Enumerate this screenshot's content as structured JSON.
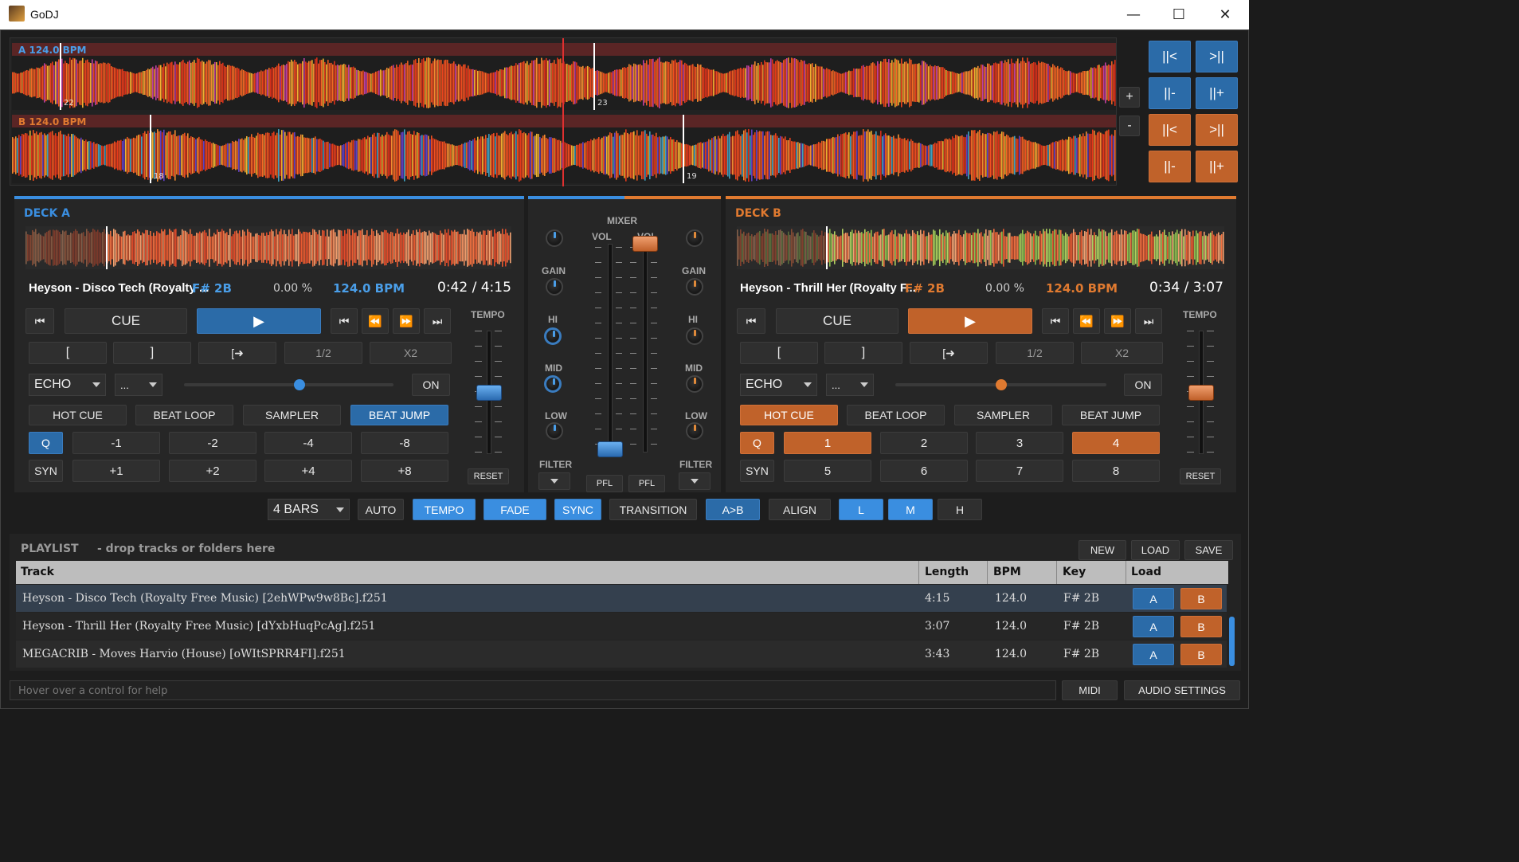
{
  "window": {
    "title": "GoDJ"
  },
  "overview": {
    "a_label": "A  124.0 BPM",
    "b_label": "B  124.0 BPM",
    "a_markers": [
      "22",
      "23"
    ],
    "b_markers": [
      "18",
      "19"
    ],
    "zoom_plus": "+",
    "zoom_minus": "-"
  },
  "jump_buttons": {
    "a": [
      "||<",
      ">||",
      "||-",
      "||+"
    ],
    "b": [
      "||<",
      ">||",
      "||-",
      "||+"
    ]
  },
  "deck_a": {
    "title": "DECK A",
    "track": "Heyson - Disco Tech (Royalty ...",
    "key": "F#  2B",
    "pitch": "0.00 %",
    "bpm": "124.0 BPM",
    "time": "0:42 / 4:15",
    "cue": "CUE",
    "loop_in": "[",
    "loop_out": "]",
    "loop_exit": "[➜",
    "half": "1/2",
    "double": "X2",
    "fx": "ECHO",
    "fx_param": "...",
    "fx_on": "ON",
    "fx_amount": 0.55,
    "tabs": [
      "HOT CUE",
      "BEAT LOOP",
      "SAMPLER",
      "BEAT JUMP"
    ],
    "active_tab": "BEAT JUMP",
    "q": "Q",
    "syn": "SYN",
    "pads_top": [
      "-1",
      "-2",
      "-4",
      "-8"
    ],
    "pads_bottom": [
      "+1",
      "+2",
      "+4",
      "+8"
    ],
    "tempo_label": "TEMPO",
    "reset": "RESET",
    "accent": "#3a8ee0"
  },
  "deck_b": {
    "title": "DECK B",
    "track": "Heyson - Thrill Her (Royalty F...",
    "key": "F#  2B",
    "pitch": "0.00 %",
    "bpm": "124.0 BPM",
    "time": "0:34 / 3:07",
    "cue": "CUE",
    "loop_in": "[",
    "loop_out": "]",
    "loop_exit": "[➜",
    "half": "1/2",
    "double": "X2",
    "fx": "ECHO",
    "fx_param": "...",
    "fx_on": "ON",
    "fx_amount": 0.5,
    "tabs": [
      "HOT CUE",
      "BEAT LOOP",
      "SAMPLER",
      "BEAT JUMP"
    ],
    "active_tab": "HOT CUE",
    "q": "Q",
    "syn": "SYN",
    "pads_top": [
      "1",
      "2",
      "3",
      "4"
    ],
    "pads_bottom": [
      "5",
      "6",
      "7",
      "8"
    ],
    "tempo_label": "TEMPO",
    "reset": "RESET",
    "accent": "#e07a30"
  },
  "mixer": {
    "title": "MIXER",
    "vol": "VOL",
    "gain": "GAIN",
    "hi": "HI",
    "mid": "MID",
    "low": "LOW",
    "filter": "FILTER",
    "pfl": "PFL"
  },
  "transition": {
    "bars": "4 BARS",
    "auto": "AUTO",
    "tempo": "TEMPO",
    "fade": "FADE",
    "sync": "SYNC",
    "transition": "TRANSITION",
    "ab": "A>B",
    "align": "ALIGN",
    "l": "L",
    "m": "M",
    "h": "H"
  },
  "playlist": {
    "title": "PLAYLIST",
    "hint": "-  drop tracks or folders here",
    "new": "NEW",
    "load": "LOAD",
    "save": "SAVE",
    "columns": [
      "Track",
      "Length",
      "BPM",
      "Key",
      "Load"
    ],
    "rows": [
      {
        "track": "Heyson - Disco Tech (Royalty Free Music) [2ehWPw9w8Bc].f251",
        "length": "4:15",
        "bpm": "124.0",
        "key": "F#  2B"
      },
      {
        "track": "Heyson - Thrill Her (Royalty Free Music) [dYxbHuqPcAg].f251",
        "length": "3:07",
        "bpm": "124.0",
        "key": "F#  2B"
      },
      {
        "track": "MEGACRIB - Moves Harvio (House) [oWItSPRR4FI].f251",
        "length": "3:43",
        "bpm": "124.0",
        "key": "F#  2B"
      }
    ],
    "load_a": "A",
    "load_b": "B"
  },
  "status": {
    "help": "Hover over a control for help",
    "midi": "MIDI",
    "audio": "AUDIO SETTINGS"
  }
}
